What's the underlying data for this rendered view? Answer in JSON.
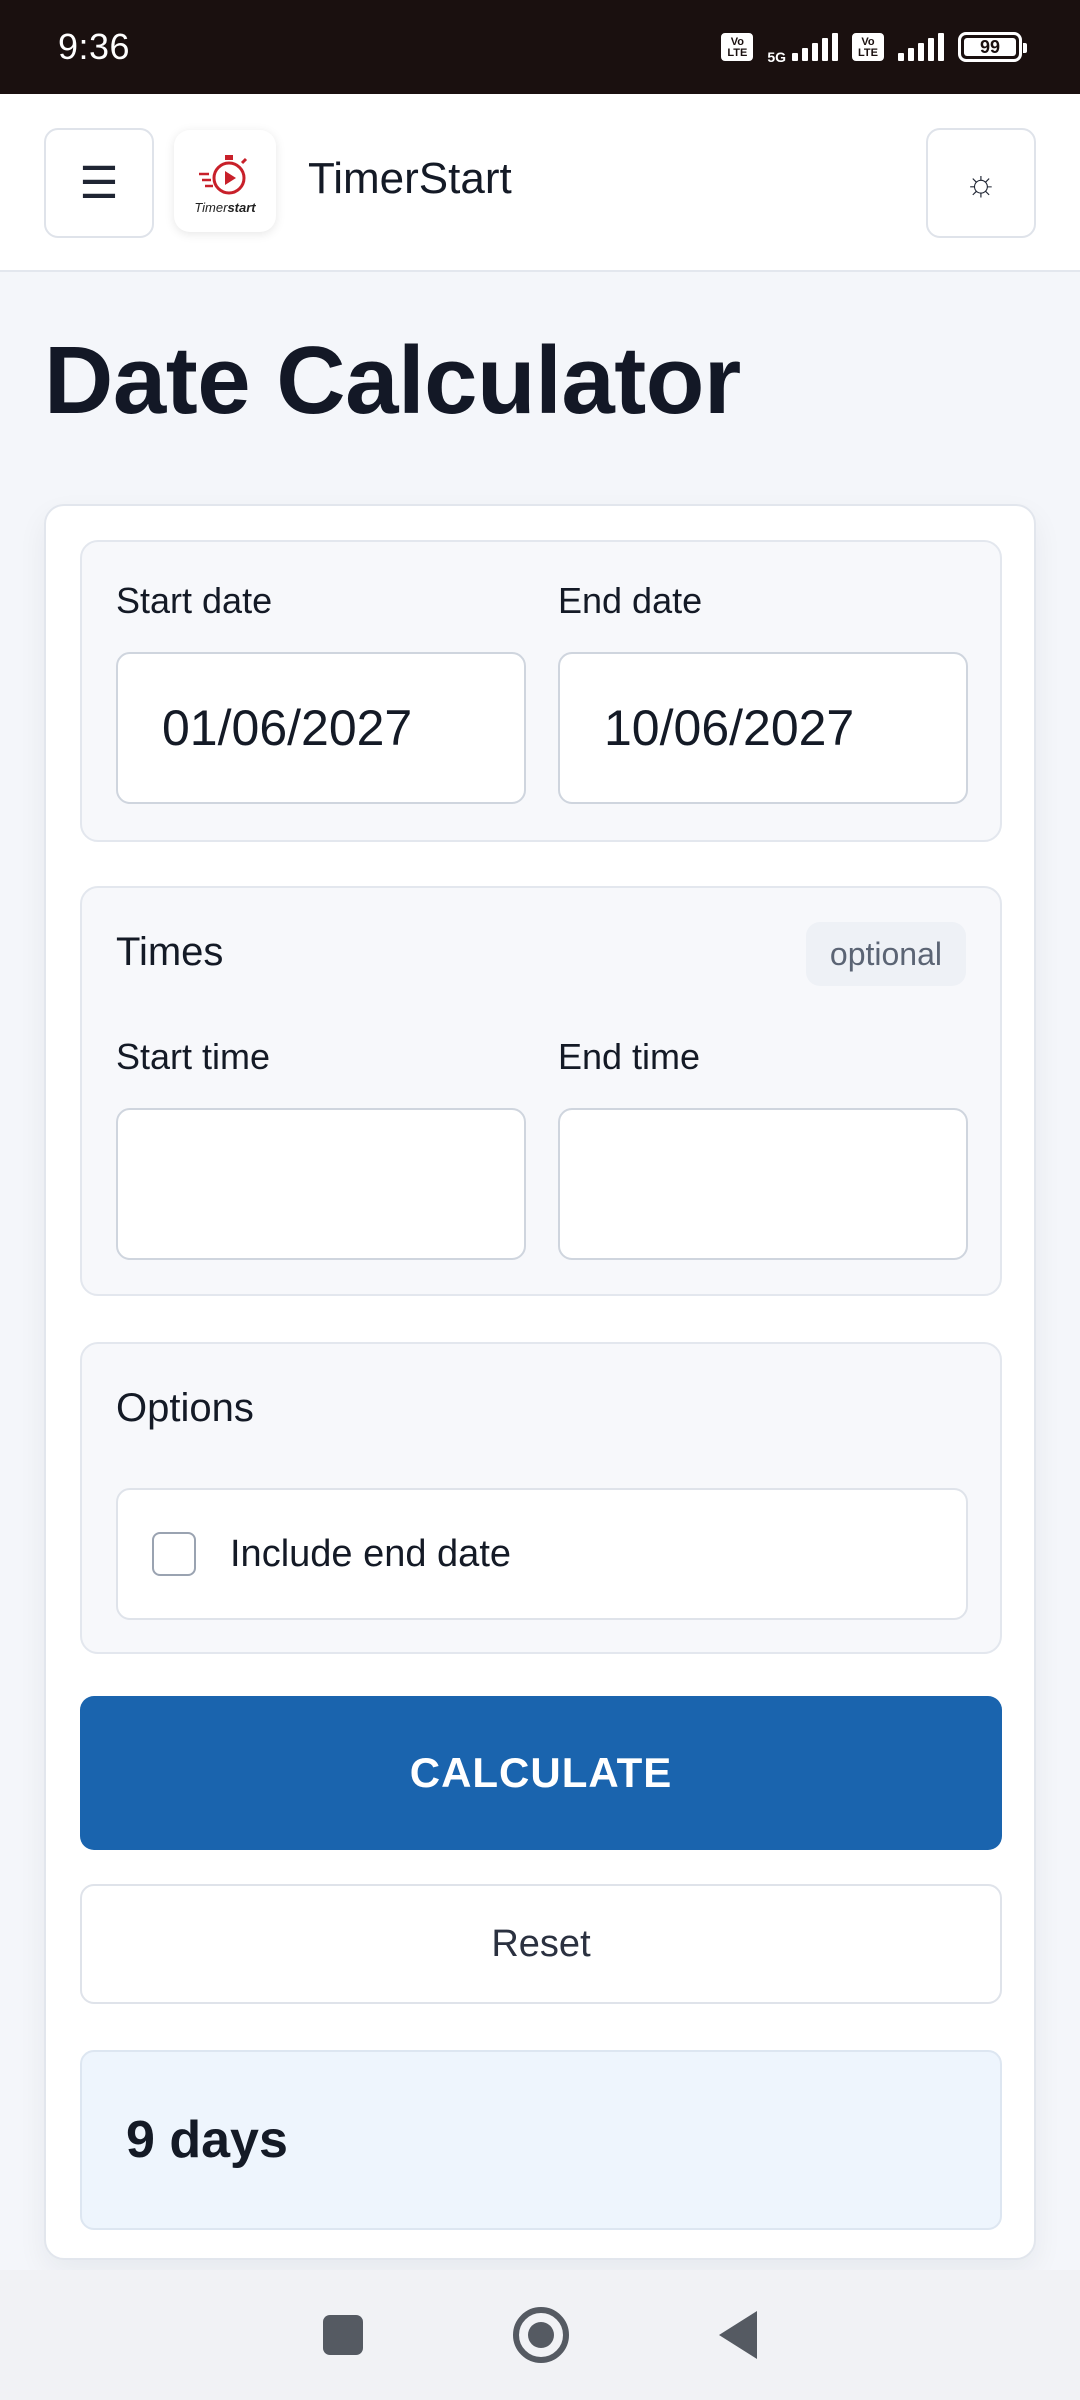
{
  "status_bar": {
    "time": "9:36",
    "network": "5G",
    "volte_label": "Vo LTE",
    "battery": "99"
  },
  "header": {
    "app_name": "TimerStart",
    "logo_text_left": "Timer",
    "logo_text_right": "start",
    "menu_icon": "☰",
    "theme_icon": "☼"
  },
  "page": {
    "title": "Date Calculator"
  },
  "dates": {
    "start_label": "Start date",
    "start_value": "01/06/2027",
    "end_label": "End date",
    "end_value": "10/06/2027"
  },
  "times": {
    "title": "Times",
    "badge": "optional",
    "start_label": "Start time",
    "start_value": "",
    "end_label": "End time",
    "end_value": ""
  },
  "options": {
    "title": "Options",
    "include_end_label": "Include end date",
    "include_end_checked": false
  },
  "actions": {
    "calculate_label": "CALCULATE",
    "reset_label": "Reset"
  },
  "result": {
    "text": "9 days"
  },
  "colors": {
    "primary": "#1a64ae",
    "logo_red": "#c8202a",
    "status_bar_bg": "#1a100f"
  }
}
